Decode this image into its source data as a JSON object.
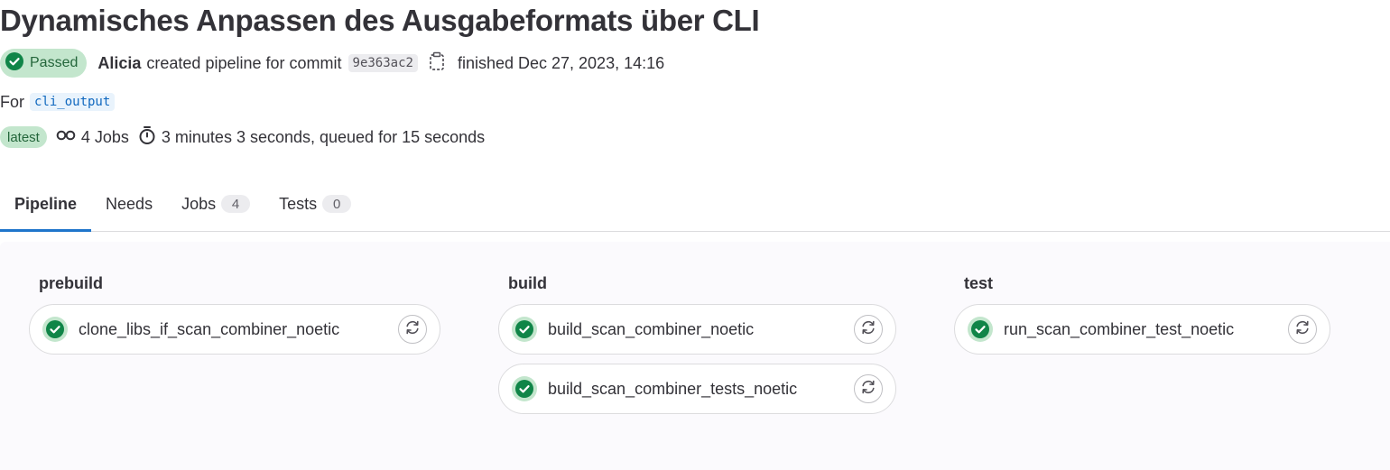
{
  "pipeline": {
    "title": "Dynamisches Anpassen des Ausgabeformats über CLI",
    "status": "Passed",
    "author": "Alicia",
    "created_text": "created pipeline for commit",
    "commit_sha": "9e363ac2",
    "finished_text": "finished Dec 27, 2023, 14:16",
    "for_label": "For",
    "branch": "cli_output",
    "latest_badge": "latest",
    "jobs_count_text": "4 Jobs",
    "duration_text": "3 minutes 3 seconds, queued for 15 seconds"
  },
  "tabs": [
    {
      "label": "Pipeline",
      "count": null,
      "active": true
    },
    {
      "label": "Needs",
      "count": null
    },
    {
      "label": "Jobs",
      "count": "4"
    },
    {
      "label": "Tests",
      "count": "0"
    }
  ],
  "stages": [
    {
      "name": "prebuild",
      "jobs": [
        {
          "name": "clone_libs_if_scan_combiner_noetic",
          "status": "success"
        }
      ]
    },
    {
      "name": "build",
      "jobs": [
        {
          "name": "build_scan_combiner_noetic",
          "status": "success"
        },
        {
          "name": "build_scan_combiner_tests_noetic",
          "status": "success"
        }
      ]
    },
    {
      "name": "test",
      "jobs": [
        {
          "name": "run_scan_combiner_test_noetic",
          "status": "success"
        }
      ]
    }
  ],
  "colors": {
    "success": "#108548",
    "success_bg": "#c3e6cd",
    "active_tab_underline": "#1f75cb",
    "branch_text": "#1068bf"
  },
  "icons": {
    "status": "status-success-icon",
    "copy": "clipboard-copy-icon",
    "jobs": "pipeline-jobs-icon",
    "duration": "timer-icon",
    "retry": "retry-icon"
  }
}
